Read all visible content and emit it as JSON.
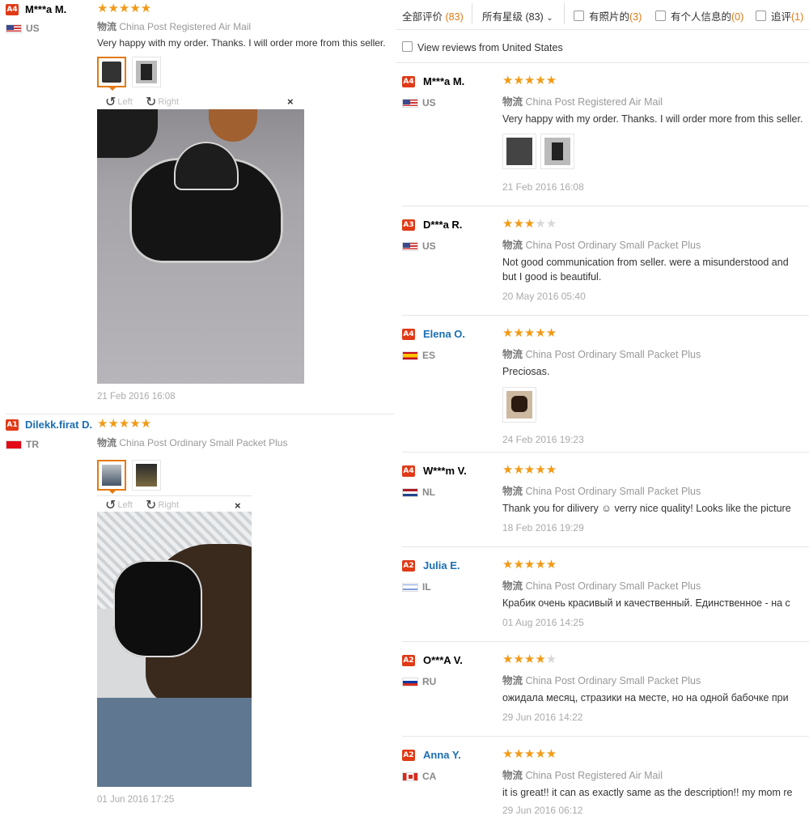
{
  "left": {
    "reviews": [
      {
        "level": "A4",
        "name": "M***a M.",
        "country": "US",
        "shipping_label": "物流",
        "shipping": "China Post Registered Air Mail",
        "text": "Very happy with my order. Thanks. I will order more from this seller.",
        "date": "21 Feb 2016 16:08"
      },
      {
        "level": "A1",
        "name": "Dilekk.firat D.",
        "country": "TR",
        "shipping_label": "物流",
        "shipping": "China Post Ordinary Small Packet Plus",
        "date": "01 Jun 2016 17:25"
      }
    ],
    "viewer": {
      "rotate_left": "Left",
      "rotate_right": "Right",
      "close": "×"
    }
  },
  "filters": {
    "all_label": "全部评价",
    "all_count": "(83)",
    "stars_select": "所有星级 (83)",
    "photos_label": "有照片的",
    "photos_count": "(3)",
    "personal_label": "有个人信息的",
    "personal_count": "(0)",
    "followup_label": "追评",
    "followup_count": "(1)",
    "country_filter": "View reviews from United States"
  },
  "right": {
    "reviews": [
      {
        "level": "A4",
        "name": "M***a M.",
        "country": "US",
        "stars": 5,
        "shipping_label": "物流",
        "shipping": "China Post Registered Air Mail",
        "text": "Very happy with my order. Thanks. I will order more from this seller.",
        "date": "21 Feb 2016 16:08"
      },
      {
        "level": "A3",
        "name": "D***a R.",
        "country": "US",
        "stars": 3,
        "shipping_label": "物流",
        "shipping": "China Post Ordinary Small Packet Plus",
        "text": "Not good communication from seller. were a misunderstood and",
        "text2": "but I good is beautiful.",
        "date": "20 May 2016 05:40"
      },
      {
        "level": "A4",
        "name": "Elena O.",
        "country": "ES",
        "stars": 5,
        "shipping_label": "物流",
        "shipping": "China Post Ordinary Small Packet Plus",
        "text": "Preciosas.",
        "date": "24 Feb 2016 19:23"
      },
      {
        "level": "A4",
        "name": "W***m V.",
        "country": "NL",
        "stars": 5,
        "shipping_label": "物流",
        "shipping": "China Post Ordinary Small Packet Plus",
        "text": "Thank you for dilivery ☺ verry nice quality! Looks like the picture",
        "date": "18 Feb 2016 19:29"
      },
      {
        "level": "A2",
        "name": "Julia E.",
        "country": "IL",
        "stars": 5,
        "shipping_label": "物流",
        "shipping": "China Post Ordinary Small Packet Plus",
        "text": "Крабик очень красивый и качественный. Единственное - на с",
        "date": "01 Aug 2016 14:25"
      },
      {
        "level": "A2",
        "name": "O***A V.",
        "country": "RU",
        "stars": 4,
        "shipping_label": "物流",
        "shipping": "China Post Ordinary Small Packet Plus",
        "text": "ожидала месяц, стразики на месте, но на одной бабочке при",
        "date": "29 Jun 2016 14:22"
      },
      {
        "level": "A2",
        "name": "Anna Y.",
        "country": "CA",
        "stars": 5,
        "shipping_label": "物流",
        "shipping": "China Post Registered Air Mail",
        "text": "it is great!! it can as exactly same as the description!! my mom re",
        "date": "29 Jun 2016 06:12"
      }
    ]
  },
  "colors": {
    "accent_orange": "#e07b12",
    "star": "#f29a17",
    "level_badge": "#e03a17",
    "link_blue": "#1a6fb4"
  }
}
